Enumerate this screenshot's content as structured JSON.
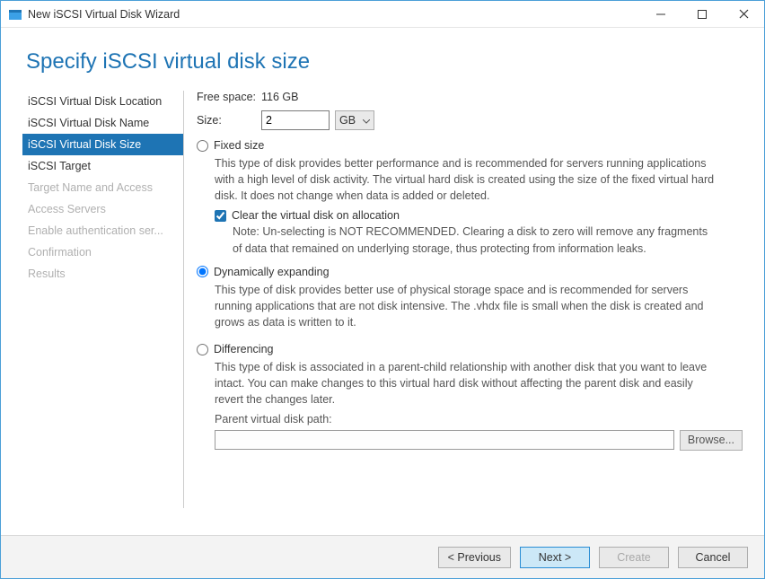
{
  "window": {
    "title": "New iSCSI Virtual Disk Wizard"
  },
  "header": {
    "title": "Specify iSCSI virtual disk size"
  },
  "sidebar": {
    "items": [
      {
        "label": "iSCSI Virtual Disk Location",
        "state": "done"
      },
      {
        "label": "iSCSI Virtual Disk Name",
        "state": "done"
      },
      {
        "label": "iSCSI Virtual Disk Size",
        "state": "current"
      },
      {
        "label": "iSCSI Target",
        "state": "done"
      },
      {
        "label": "Target Name and Access",
        "state": "disabled"
      },
      {
        "label": "Access Servers",
        "state": "disabled"
      },
      {
        "label": "Enable authentication ser...",
        "state": "disabled"
      },
      {
        "label": "Confirmation",
        "state": "disabled"
      },
      {
        "label": "Results",
        "state": "disabled"
      }
    ]
  },
  "main": {
    "free_space_label": "Free space:",
    "free_space_value": "116 GB",
    "size_label": "Size:",
    "size_value": "2",
    "size_unit": "GB",
    "fixed": {
      "label": "Fixed size",
      "desc": "This type of disk provides better performance and is recommended for servers running applications with a high level of disk activity. The virtual hard disk is created using the size of the fixed virtual hard disk. It does not change when data is added or deleted.",
      "clear_label": "Clear the virtual disk on allocation",
      "clear_checked": true,
      "note": "Note: Un-selecting is NOT RECOMMENDED. Clearing a disk to zero will remove any fragments of data that remained on underlying storage, thus protecting from information leaks."
    },
    "dynamic": {
      "label": "Dynamically expanding",
      "selected": true,
      "desc": "This type of disk provides better use of physical storage space and is recommended for servers running applications that are not disk intensive. The .vhdx file is small when the disk is created and grows as data is written to it."
    },
    "diff": {
      "label": "Differencing",
      "desc": "This type of disk is associated in a parent-child relationship with another disk that you want to leave intact. You can make changes to this virtual hard disk without affecting the parent disk and easily revert the changes later.",
      "path_label": "Parent virtual disk path:",
      "path_value": "",
      "browse_label": "Browse..."
    }
  },
  "footer": {
    "previous": "< Previous",
    "next": "Next >",
    "create": "Create",
    "cancel": "Cancel"
  }
}
